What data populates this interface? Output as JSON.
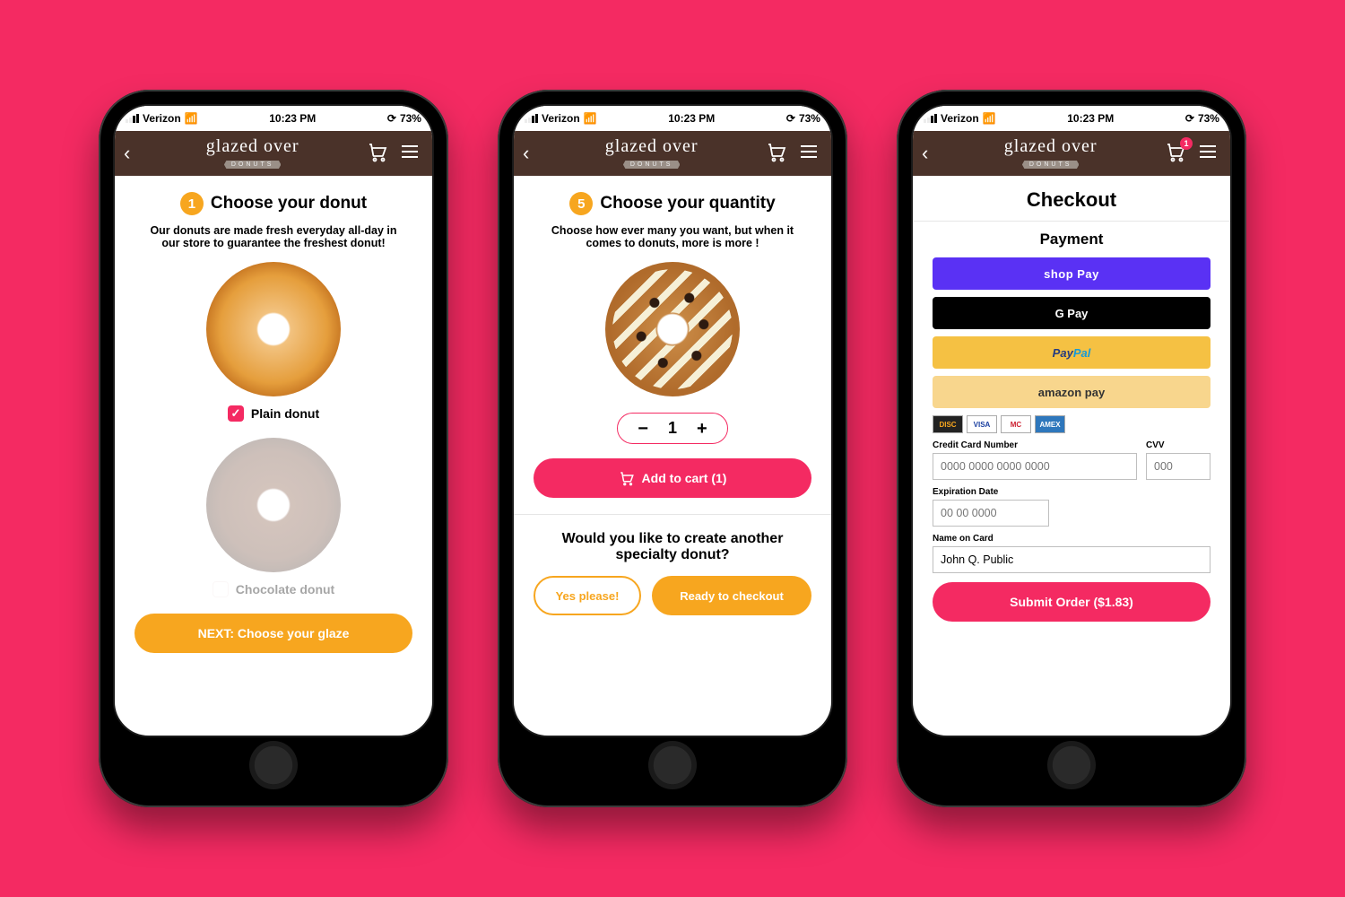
{
  "status": {
    "carrier": "Verizon",
    "time": "10:23 PM",
    "battery": "73%"
  },
  "brand": {
    "name": "glazed over",
    "tag": "DONUTS"
  },
  "screen1": {
    "step": "1",
    "title": "Choose your donut",
    "sub": "Our donuts are made fresh everyday all-day in our store to guarantee the freshest donut!",
    "opt1": "Plain donut",
    "opt2": "Chocolate donut",
    "next": "NEXT: Choose your glaze"
  },
  "screen2": {
    "step": "5",
    "title": "Choose your quantity",
    "sub": "Choose how ever many you want, but when it comes to donuts, more is more !",
    "qty": "1",
    "add": "Add to cart (1)",
    "q": "Would you like to create another specialty donut?",
    "yes": "Yes please!",
    "ready": "Ready to checkout"
  },
  "screen3": {
    "title": "Checkout",
    "pay_title": "Payment",
    "cart_badge": "1",
    "shoppay": "shop Pay",
    "gpay": "G Pay",
    "paypal_a": "Pay",
    "paypal_b": "Pal",
    "amazon": "amazon pay",
    "cards": [
      "DISC",
      "VISA",
      "MC",
      "AMEX"
    ],
    "cc_label": "Credit Card Number",
    "cc_ph": "0000 0000 0000 0000",
    "cvv_label": "CVV",
    "cvv_ph": "000",
    "exp_label": "Expiration Date",
    "exp_ph": "00 00 0000",
    "name_label": "Name on Card",
    "name_val": "John Q. Public",
    "submit": "Submit Order ($1.83)"
  }
}
